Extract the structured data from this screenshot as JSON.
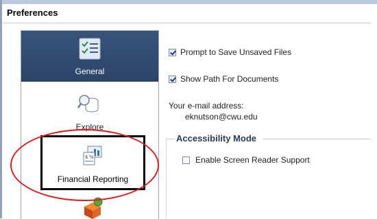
{
  "window": {
    "title": "Preferences"
  },
  "sidebar": {
    "items": [
      {
        "label": "General",
        "icon": "checklist-icon",
        "selected": true
      },
      {
        "label": "Explore",
        "icon": "magnifier-database-icon",
        "selected": false
      },
      {
        "label": "Financial Reporting",
        "icon": "financial-report-icon",
        "selected": false
      },
      {
        "label": "",
        "icon": "cube-tools-icon",
        "selected": false
      }
    ]
  },
  "general": {
    "prompt_save": {
      "label": "Prompt to Save Unsaved Files",
      "checked": true
    },
    "show_path": {
      "label": "Show Path For Documents",
      "checked": true
    },
    "email_label": "Your e-mail address:",
    "email_value": "eknutson@cwu.edu"
  },
  "accessibility": {
    "heading": "Accessibility Mode",
    "screen_reader": {
      "label": "Enable Screen Reader Support",
      "checked": false
    }
  },
  "colors": {
    "selected_bg": "#2f4a70",
    "annotation_oval": "#e01b1b",
    "annotation_box": "#000000"
  }
}
